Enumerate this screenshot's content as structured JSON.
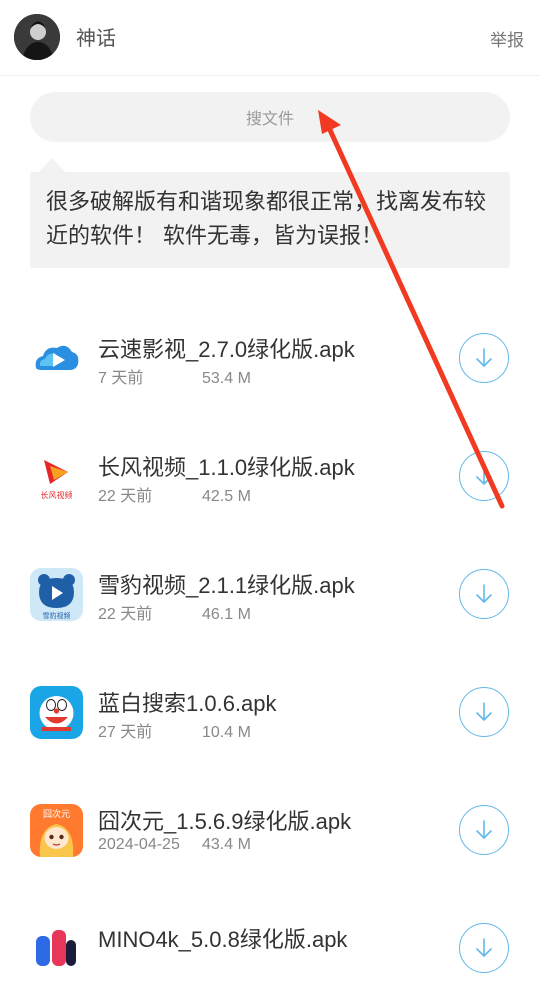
{
  "header": {
    "username": "神话",
    "report_label": "举报"
  },
  "search": {
    "placeholder": "搜文件"
  },
  "notice": {
    "text": "很多破解版有和谐现象都很正常，找离发布较近的软件！ 软件无毒，皆为误报！"
  },
  "files": [
    {
      "name": "云速影视_2.7.0绿化版.apk",
      "date": "7 天前",
      "size": "53.4 M",
      "icon": "cloud-play-icon"
    },
    {
      "name": "长风视频_1.1.0绿化版.apk",
      "date": "22 天前",
      "size": "42.5 M",
      "icon": "changfeng-video-icon"
    },
    {
      "name": "雪豹视频_2.1.1绿化版.apk",
      "date": "22 天前",
      "size": "46.1 M",
      "icon": "xuebao-video-icon"
    },
    {
      "name": "蓝白搜索1.0.6.apk",
      "date": "27 天前",
      "size": "10.4 M",
      "icon": "doraemon-icon"
    },
    {
      "name": "囧次元_1.5.6.9绿化版.apk",
      "date": "2024-04-25",
      "size": "43.4 M",
      "icon": "jiongciyuan-icon"
    },
    {
      "name": "MINO4k_5.0.8绿化版.apk",
      "date": "",
      "size": "",
      "icon": "mino4k-icon"
    }
  ],
  "icon_text": {
    "changfeng": "长风视频",
    "xuebao": "雪豹视频",
    "jiongciyuan": "囧次元"
  },
  "colors": {
    "accent_blue": "#62b9ea",
    "annotation_arrow": "#f23a22"
  }
}
